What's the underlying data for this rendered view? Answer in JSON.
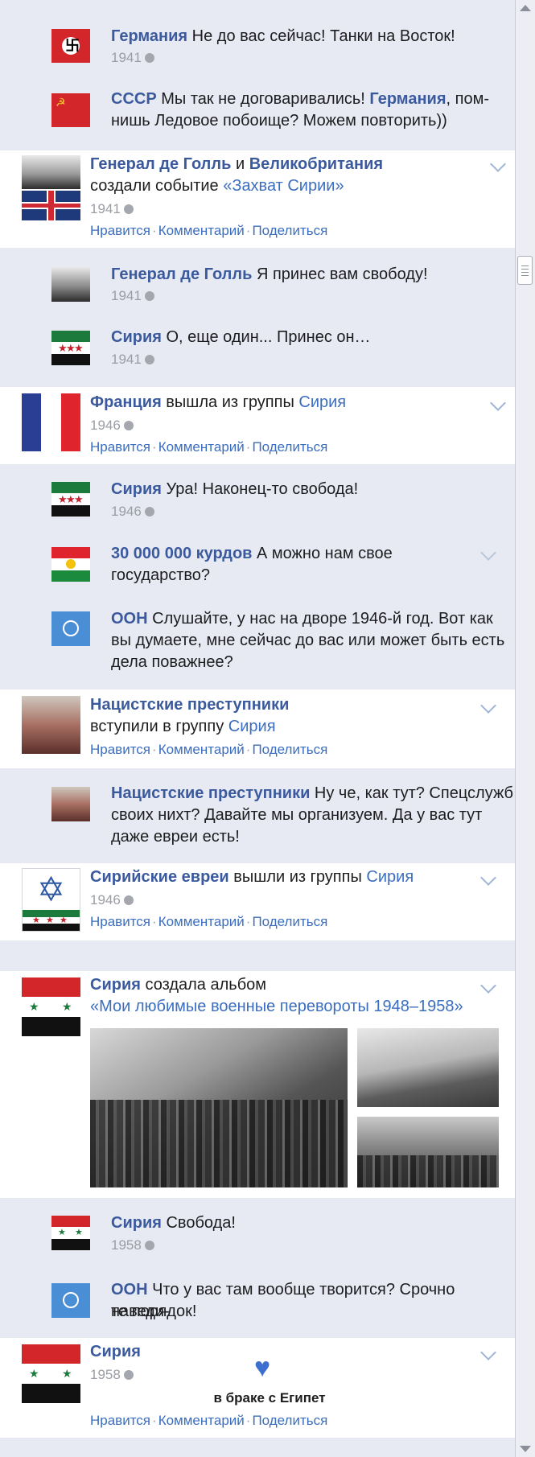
{
  "ui": {
    "like": "Нравится",
    "comment": "Комментарий",
    "share": "Поделиться",
    "sep": "·"
  },
  "entries": {
    "e1": {
      "name": "Германия",
      "text": " Не до вас сейчас! Танки на Восток!",
      "date": "1941"
    },
    "e2": {
      "name": "СССР",
      "text1": " Мы так не договаривались! ",
      "name2": "Германия",
      "text2": ", пом-",
      "text3": "нишь Ледовое побоище? Можем повторить))"
    },
    "p1": {
      "name1": "Генерал де Голль",
      "and": " и ",
      "name2": "Великобритания",
      "text": "создали событие ",
      "link": "«Захват Сирии»",
      "date": "1941"
    },
    "e3": {
      "name": "Генерал де Голль",
      "text": " Я принес вам свободу!",
      "date": "1941"
    },
    "e4": {
      "name": "Сирия",
      "text": " О, еще один... Принес он…",
      "date": "1941"
    },
    "p2": {
      "name": "Франция",
      "text": " вышла из группы ",
      "link": "Сирия",
      "date": "1946"
    },
    "e5": {
      "name": "Сирия",
      "text": " Ура! Наконец-то свобода!",
      "date": "1946"
    },
    "e6": {
      "name": "30 000 000 курдов",
      "text1": " А можно нам свое",
      "text2": "государство?"
    },
    "e7": {
      "name": "ООН",
      "text1": " Слушайте, у нас на дворе 1946-й год. Вот как",
      "text2": "вы думаете, мне сейчас до вас или может быть есть",
      "text3": "дела поважнее?"
    },
    "p3": {
      "name": "Нацистские преступники",
      "text": "вступили в группу ",
      "link": "Сирия"
    },
    "e8": {
      "name": "Нацистские преступники",
      "text1": " Ну че, как тут? Спецслужб",
      "text2": "своих нихт? Давайте мы организуем. Да у вас тут",
      "text3": "даже евреи есть!"
    },
    "p4": {
      "name": "Сирийские евреи",
      "text": " вышли из группы ",
      "link": "Сирия",
      "date": "1946"
    },
    "p5": {
      "name": "Сирия",
      "text": " создала альбом",
      "link": "«Мои любимые военные перевороты 1948–1958»"
    },
    "e9": {
      "name": "Сирия",
      "text": " Свобода!",
      "date": "1958"
    },
    "e10": {
      "name": "ООН",
      "text1": " Что у вас там вообще творится? Срочно наведи-",
      "text2": "те порядок!"
    },
    "p6": {
      "name": "Сирия",
      "date": "1958",
      "status": "в браке с Египет"
    }
  },
  "colors": {
    "name": "#3b5a9e",
    "link": "#3b6ec0",
    "heart": "#3d6fd0",
    "subBackground": "#e7eaf3",
    "postBackground": "#ffffff"
  },
  "icons": [
    "globe-icon",
    "chevron-down-icon",
    "heart-icon"
  ]
}
